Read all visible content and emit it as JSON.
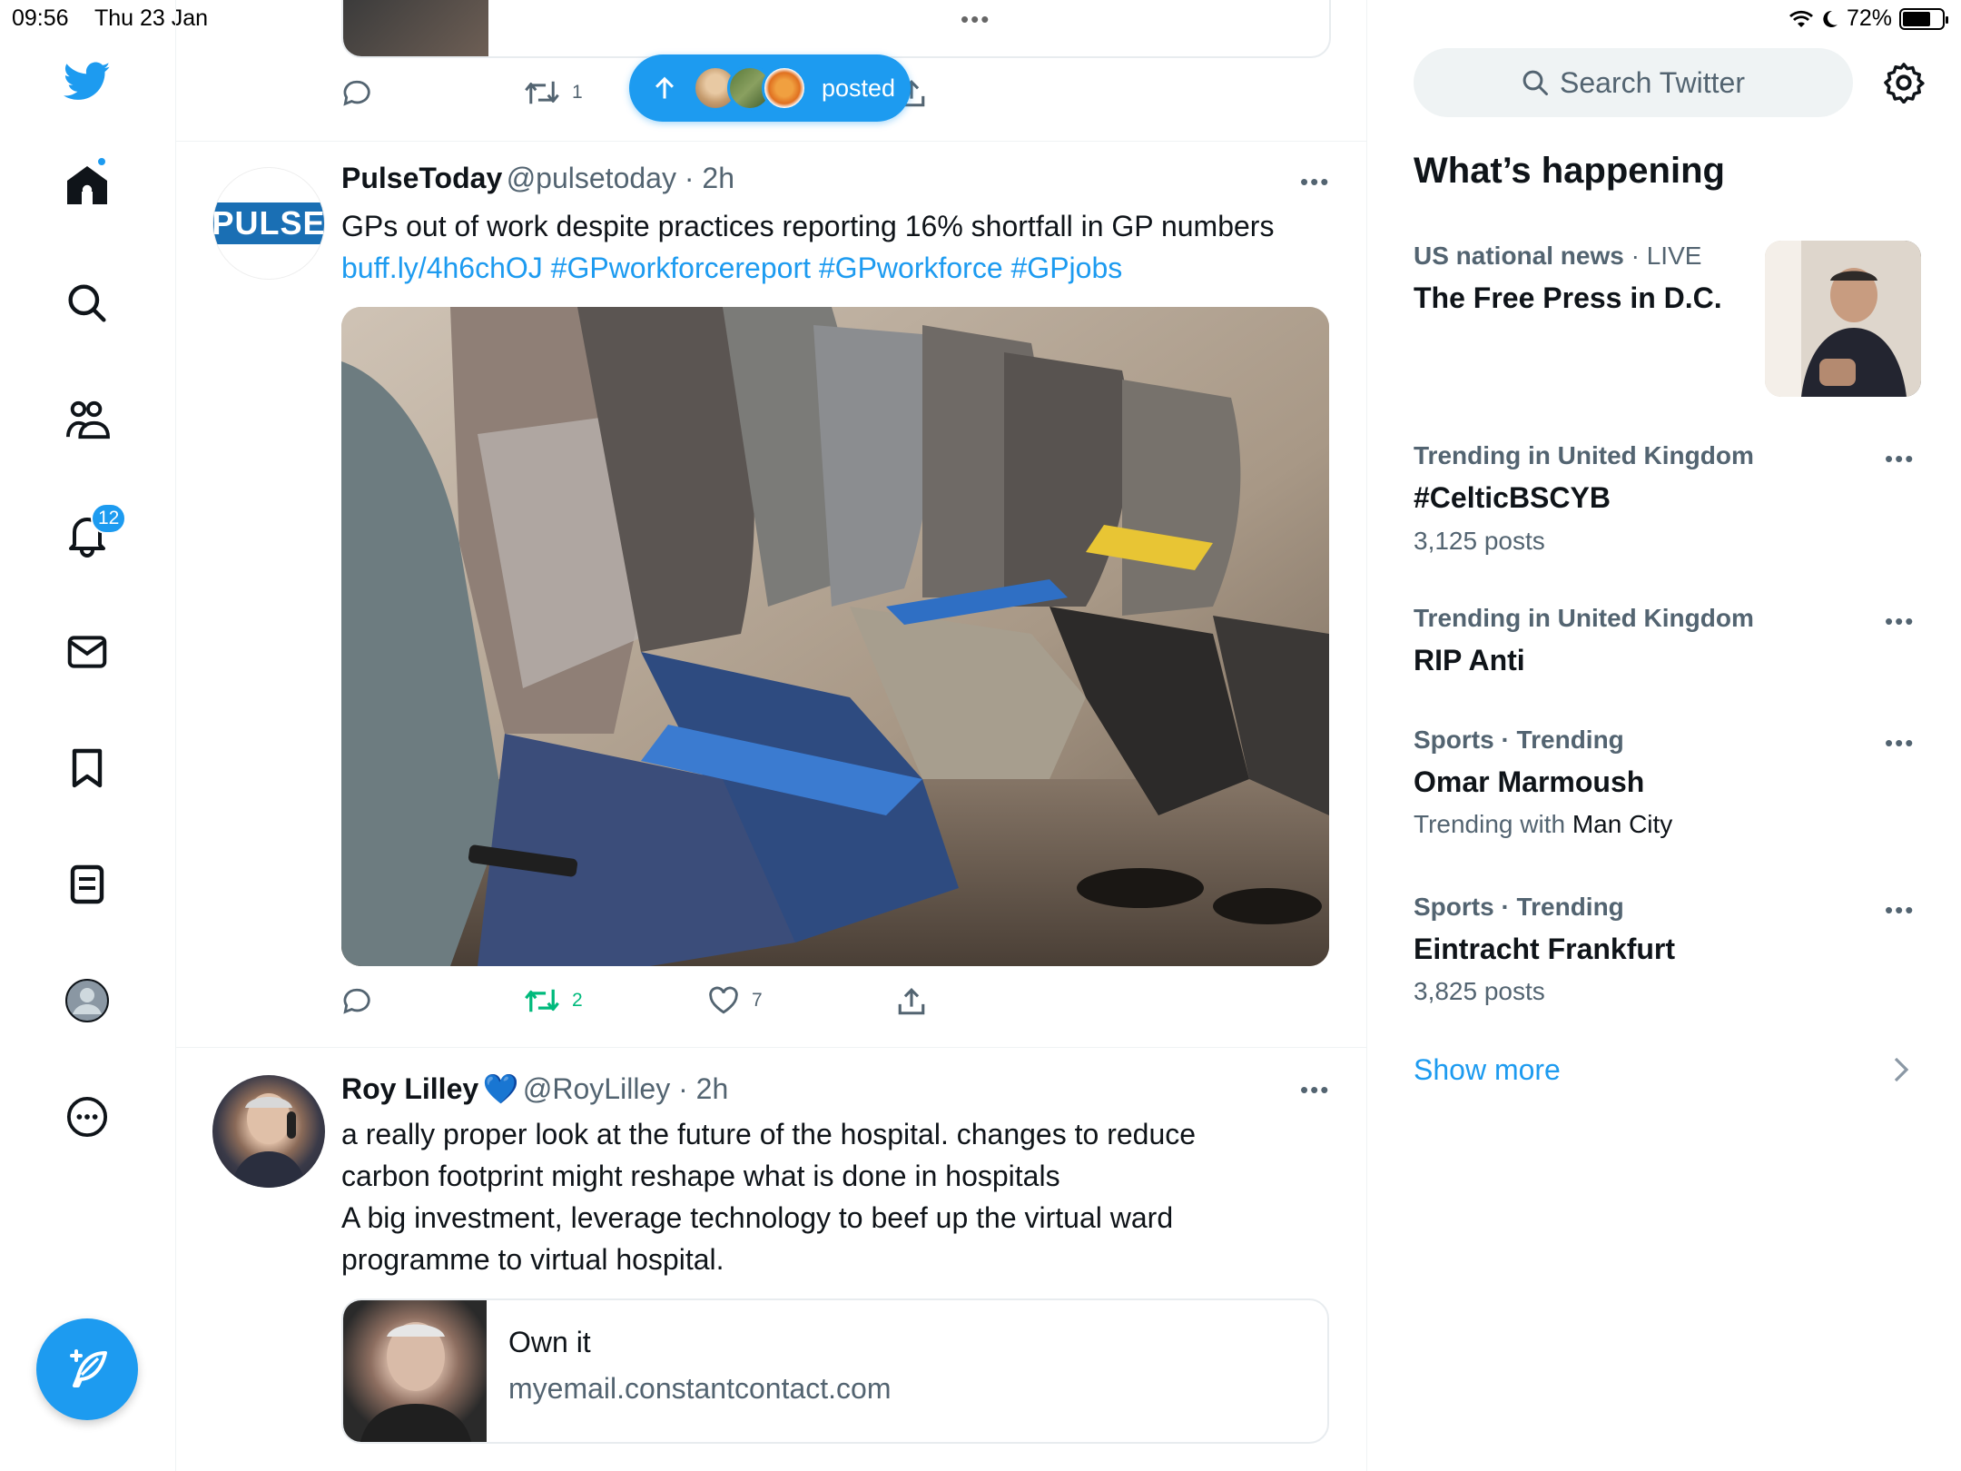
{
  "status_bar": {
    "time": "09:56",
    "date": "Thu 23 Jan",
    "battery": "72%"
  },
  "nav": {
    "notifications_count": "12"
  },
  "new_posts_pill": {
    "label": "posted"
  },
  "top_tweet": {
    "retweet_count": "1"
  },
  "tweet1": {
    "name": "PulseToday",
    "handle": "@pulsetoday",
    "time": "2h",
    "avatar_text": "PULSE",
    "text_plain": "GPs out of work despite practices reporting 16% shortfall in GP numbers",
    "link": "buff.ly/4h6chOJ",
    "hashtags": [
      "#GPworkforcereport",
      "#GPworkforce",
      "#GPjobs"
    ],
    "retweet_count": "2",
    "like_count": "7"
  },
  "tweet2": {
    "name": "Roy Lilley",
    "emoji": "💙",
    "handle": "@RoyLilley",
    "time": "2h",
    "line1": "a really proper look at the future of the hospital. changes to reduce",
    "line2": "carbon footprint might reshape what is done in hospitals",
    "line3": "A big investment, leverage technology to beef up the virtual ward",
    "line4": "programme to virtual hospital.",
    "card_title": "Own it",
    "card_domain": "myemail.constantcontact.com"
  },
  "sidebar": {
    "search_placeholder": "Search Twitter",
    "heading": "What’s happening",
    "news": {
      "category": "US national news",
      "status": "LIVE",
      "title": "The Free Press in D.C."
    },
    "trends": [
      {
        "meta": "Trending in United Kingdom",
        "name": "#CelticBSCYB",
        "posts": "3,125 posts"
      },
      {
        "meta": "Trending in United Kingdom",
        "name": "RIP Anti"
      },
      {
        "meta": "Sports · Trending",
        "name": "Omar Marmoush",
        "with_label": "Trending with",
        "with_value": "Man City"
      },
      {
        "meta": "Sports · Trending",
        "name": "Eintracht Frankfurt",
        "posts": "3,825 posts"
      }
    ],
    "show_more": "Show more"
  },
  "colors": {
    "accent": "#1d9bf0",
    "retweet_green": "#00ba7c",
    "text": "#0f1419",
    "muted": "#536471"
  }
}
